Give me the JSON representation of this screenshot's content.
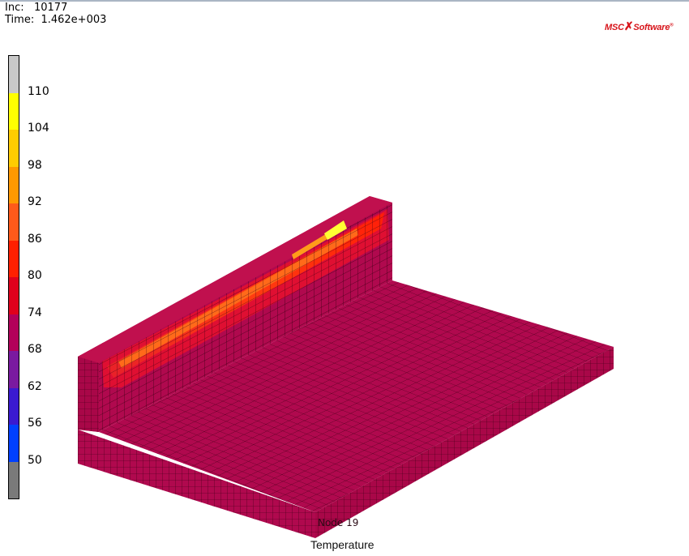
{
  "header": {
    "inc_label": "Inc:   10177",
    "time_label": "Time:  1.462e+003"
  },
  "logo": {
    "text_left": "MSC",
    "text_right": "Software"
  },
  "legend": {
    "labels": [
      "110",
      "104",
      "98",
      "92",
      "86",
      "80",
      "74",
      "68",
      "62",
      "56",
      "50"
    ],
    "colors": [
      "#c8c8c8",
      "#ffff00",
      "#ffcc00",
      "#ff9900",
      "#ff5a1a",
      "#ff2000",
      "#e0001c",
      "#b3005a",
      "#7a1aa0",
      "#3a1ad0",
      "#0040ff",
      "#7a7a7a"
    ]
  },
  "model": {
    "mesh_color": "#b0094e",
    "grid_color": "#3a0013",
    "hot_colors": [
      "#ff2a10",
      "#ff6a1a",
      "#ff9c1a",
      "#ffff33"
    ]
  },
  "footer": {
    "node_text": "Node 19",
    "caption": "Temperature"
  }
}
